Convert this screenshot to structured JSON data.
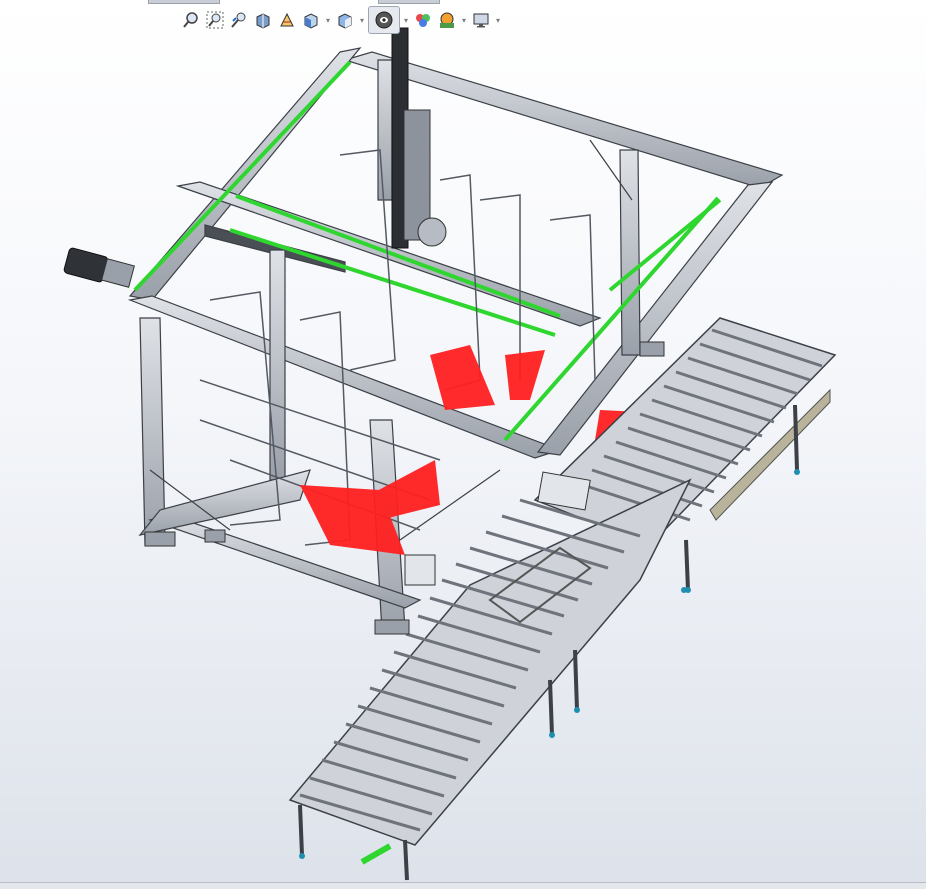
{
  "window": {
    "title": ""
  },
  "toolbar": {
    "buttons": [
      {
        "icon": "zoom-to-fit-icon"
      },
      {
        "icon": "zoom-to-area-icon"
      },
      {
        "icon": "previous-view-icon"
      },
      {
        "icon": "section-view-icon"
      },
      {
        "icon": "dynamic-annotation-views-icon"
      },
      {
        "icon": "view-orientation-icon",
        "dropdown": true
      },
      {
        "icon": "display-style-icon",
        "dropdown": true
      },
      {
        "icon": "hide-show-items-icon",
        "dropdown": true,
        "active": true
      },
      {
        "icon": "edit-appearance-icon"
      },
      {
        "icon": "apply-scene-icon",
        "dropdown": true
      },
      {
        "icon": "view-settings-icon",
        "dropdown": true
      }
    ]
  },
  "model": {
    "description_visible": false,
    "colors": {
      "frame": "#c4c8cf",
      "frame_dark": "#6b7079",
      "belt": "#2fd62f",
      "safety_panel": "#ff2020",
      "roller": "#b8bdc5",
      "motor": "#3a3d42",
      "foot_accent": "#1f8fb0"
    }
  }
}
